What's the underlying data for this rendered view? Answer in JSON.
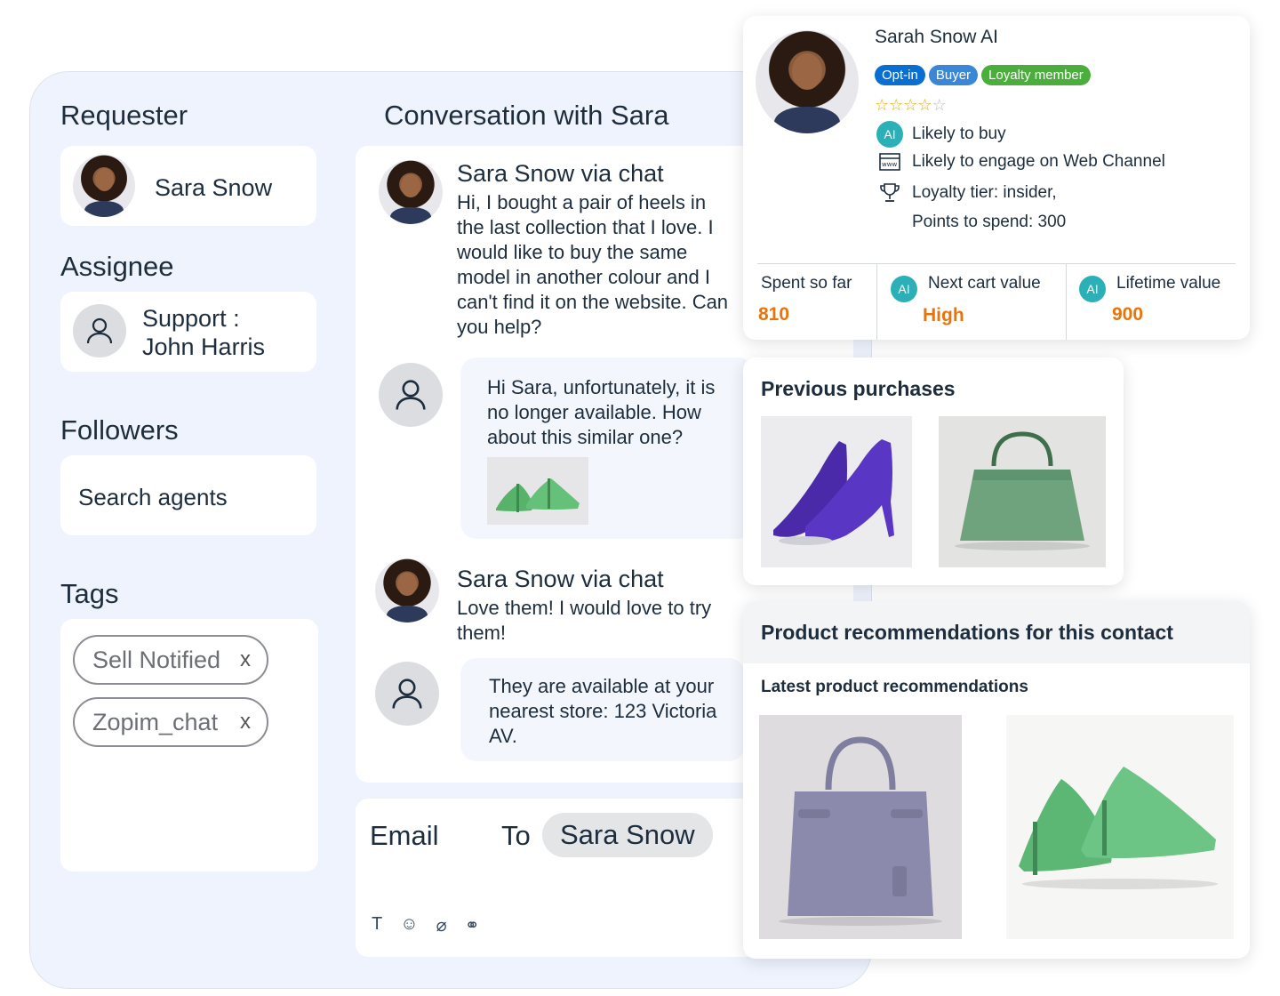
{
  "left_panel": {
    "requester_title": "Requester",
    "requester_name": "Sara Snow",
    "assignee_title": "Assignee",
    "assignee_line1": "Support :",
    "assignee_line2": "John Harris",
    "followers_title": "Followers",
    "followers_placeholder": "Search agents",
    "tags_title": "Tags",
    "tags": [
      {
        "label": "Sell Notified",
        "remove": "x"
      },
      {
        "label": "Zopim_chat",
        "remove": "x"
      }
    ]
  },
  "conversation": {
    "title": "Conversation with Sara",
    "messages": [
      {
        "sender": "Sara Snow via chat",
        "text": "Hi, I bought a pair of heels in the last collection that I love. I would like to buy the same model in another colour and I can't find it on the website. Can you help?"
      },
      {
        "text": "Hi Sara, unfortunately, it is no longer available. How about this similar one?"
      },
      {
        "sender": "Sara Snow via chat",
        "text": "Love them! I would love to try them!"
      },
      {
        "text": "They are available at your nearest store: 123 Victoria AV."
      }
    ]
  },
  "composer": {
    "channel": "Email",
    "to_label": "To",
    "recipient": "Sara Snow",
    "tools": [
      "text-format-icon",
      "emoji-icon",
      "attachment-icon",
      "link-icon"
    ],
    "tool_glyphs": [
      "T",
      "☺",
      "⌀",
      "⚭"
    ]
  },
  "profile": {
    "name": "Sarah Snow AI",
    "badges": [
      {
        "label": "Opt-in",
        "color": "#0a6ed1"
      },
      {
        "label": "Buyer",
        "color": "#3a87d6"
      },
      {
        "label": "Loyalty member",
        "color": "#4bae3c"
      }
    ],
    "rating": 4,
    "rating_max": 5,
    "insights": {
      "ai_chip": "AI",
      "likely_buy": "Likely to buy",
      "web_channel": "Likely to engage on Web Channel",
      "loyalty_tier": "Loyalty tier: insider,",
      "points": "Points to spend: 300"
    },
    "metrics": {
      "spent_label": "Spent so far",
      "spent_value": "810",
      "next_cart_label": "Next cart value",
      "next_cart_value": "High",
      "lifetime_label": "Lifetime value",
      "lifetime_value": "900"
    }
  },
  "previous_purchases": {
    "title": "Previous purchases"
  },
  "recommendations": {
    "title": "Product recommendations for this contact",
    "subtitle": "Latest product recommendations"
  },
  "colors": {
    "accent_orange": "#e8740c",
    "ai_teal": "#2bb0b8",
    "panel_bg": "#eef3fd"
  }
}
